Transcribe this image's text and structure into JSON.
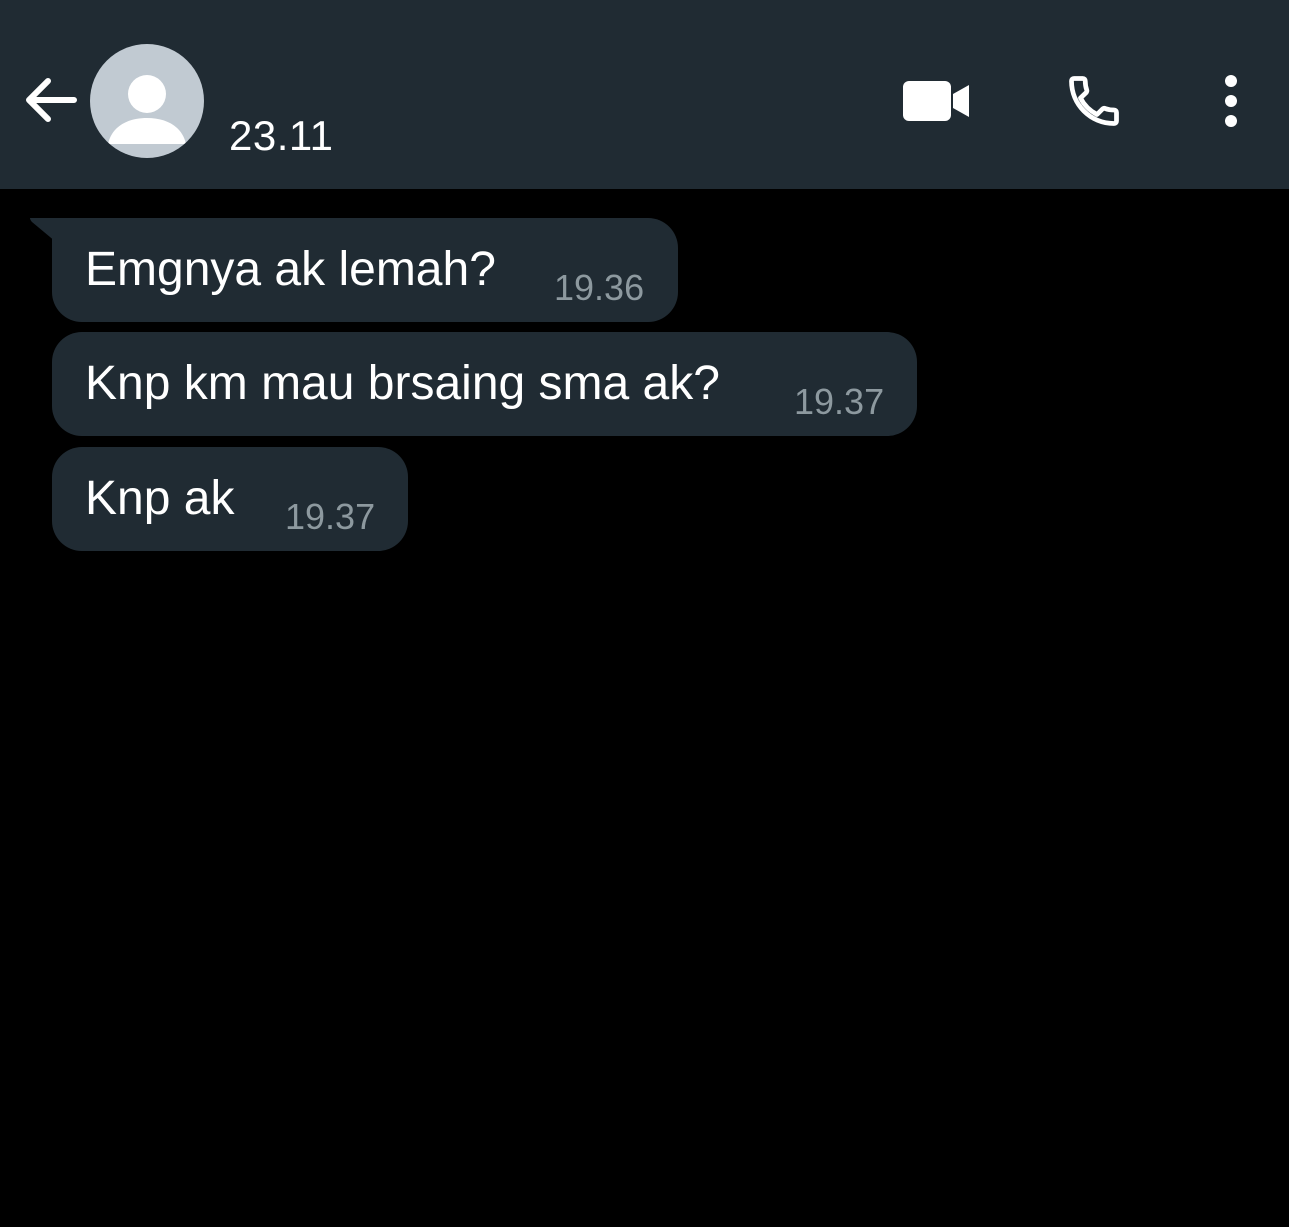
{
  "header": {
    "contact_name": "23.11",
    "icons": {
      "back": "arrow-left-icon",
      "avatar": "default-avatar",
      "video": "video-camera-icon",
      "call": "phone-icon",
      "menu": "more-vertical-icon"
    }
  },
  "messages": [
    {
      "text": "Emgnya ak lemah?",
      "time": "19.36"
    },
    {
      "text": "Knp km mau brsaing sma ak?",
      "time": "19.37"
    },
    {
      "text": "Knp ak",
      "time": "19.37"
    }
  ],
  "colors": {
    "header_bg": "#202b33",
    "bubble_bg": "#202b33",
    "chat_bg": "#000000",
    "text": "#ffffff",
    "timestamp": "#8d999f"
  }
}
